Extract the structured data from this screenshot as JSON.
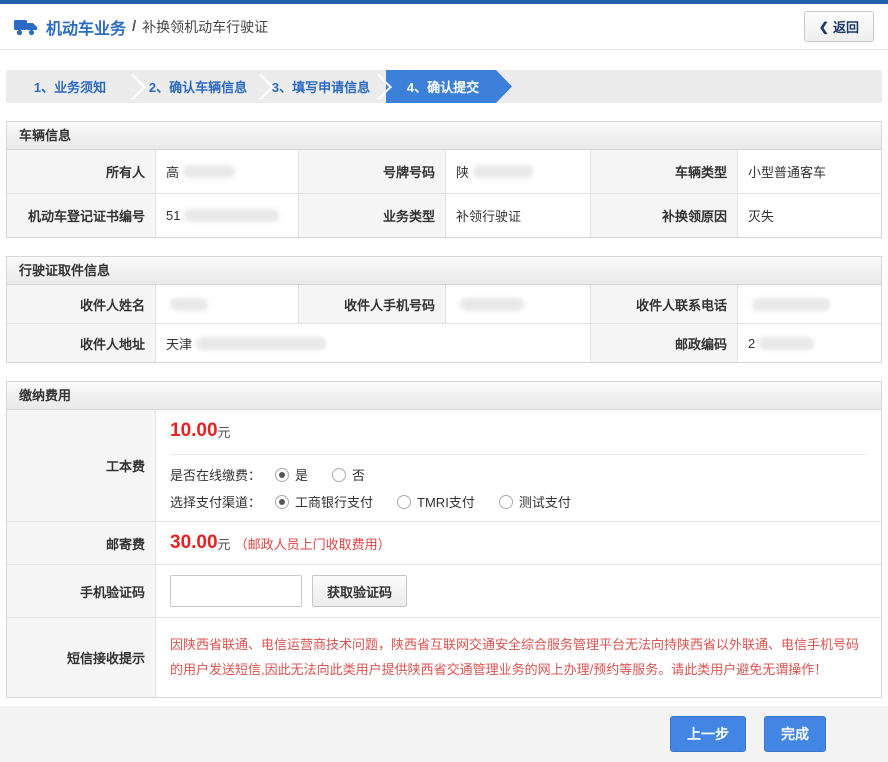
{
  "colors": {
    "topbar_blue": "#2361ab",
    "accent_blue": "#3d80d9",
    "button_blue": "#4285e3",
    "link_blue": "#2d6ac2",
    "amount_red": "#e62222",
    "notice_red": "#d9534f"
  },
  "icons": {
    "truck": "truck-icon",
    "back_chevron": "❮"
  },
  "header": {
    "title": "机动车业务",
    "separator": "/",
    "subtitle": "补换领机动车行驶证",
    "back_label": "返回"
  },
  "steps": [
    {
      "label": "1、业务须知",
      "active": false
    },
    {
      "label": "2、确认车辆信息",
      "active": false
    },
    {
      "label": "3、填写申请信息",
      "active": false
    },
    {
      "label": "4、确认提交",
      "active": true
    }
  ],
  "vehicle": {
    "title": "车辆信息",
    "owner_label": "所有人",
    "owner_value": "高",
    "plate_label": "号牌号码",
    "plate_value": "陕",
    "type_label": "车辆类型",
    "type_value": "小型普通客车",
    "cert_label": "机动车登记证书编号",
    "cert_value": "51",
    "biz_label": "业务类型",
    "biz_value": "补领行驶证",
    "reason_label": "补换领原因",
    "reason_value": "灭失"
  },
  "delivery": {
    "title": "行驶证取件信息",
    "name_label": "收件人姓名",
    "name_value": "",
    "mobile_label": "收件人手机号码",
    "mobile_value": "",
    "phone_label": "收件人联系电话",
    "phone_value": "",
    "address_label": "收件人地址",
    "address_value": "天津",
    "zip_label": "邮政编码",
    "zip_value": "2"
  },
  "payment": {
    "title": "缴纳费用",
    "cost": {
      "label": "工本费",
      "amount": "10.00",
      "unit": "元",
      "online_question": "是否在线缴费：",
      "online_options": [
        "是",
        "否"
      ],
      "online_selected": "是",
      "channel_question": "选择支付渠道：",
      "channel_options": [
        "工商银行支付",
        "TMRI支付",
        "测试支付"
      ],
      "channel_selected": "工商银行支付"
    },
    "postage": {
      "label": "邮寄费",
      "amount": "30.00",
      "unit": "元",
      "note": "（邮政人员上门收取费用）"
    },
    "sms_code": {
      "label": "手机验证码",
      "input_value": "",
      "button_label": "获取验证码"
    },
    "notice": {
      "label": "短信接收提示",
      "text": "因陕西省联通、电信运营商技术问题，陕西省互联网交通安全综合服务管理平台无法向持陕西省以外联通、电信手机号码的用户发送短信,因此无法向此类用户提供陕西省交通管理业务的网上办理/预约等服务。请此类用户避免无谓操作！"
    }
  },
  "footer": {
    "prev_label": "上一步",
    "finish_label": "完成"
  }
}
